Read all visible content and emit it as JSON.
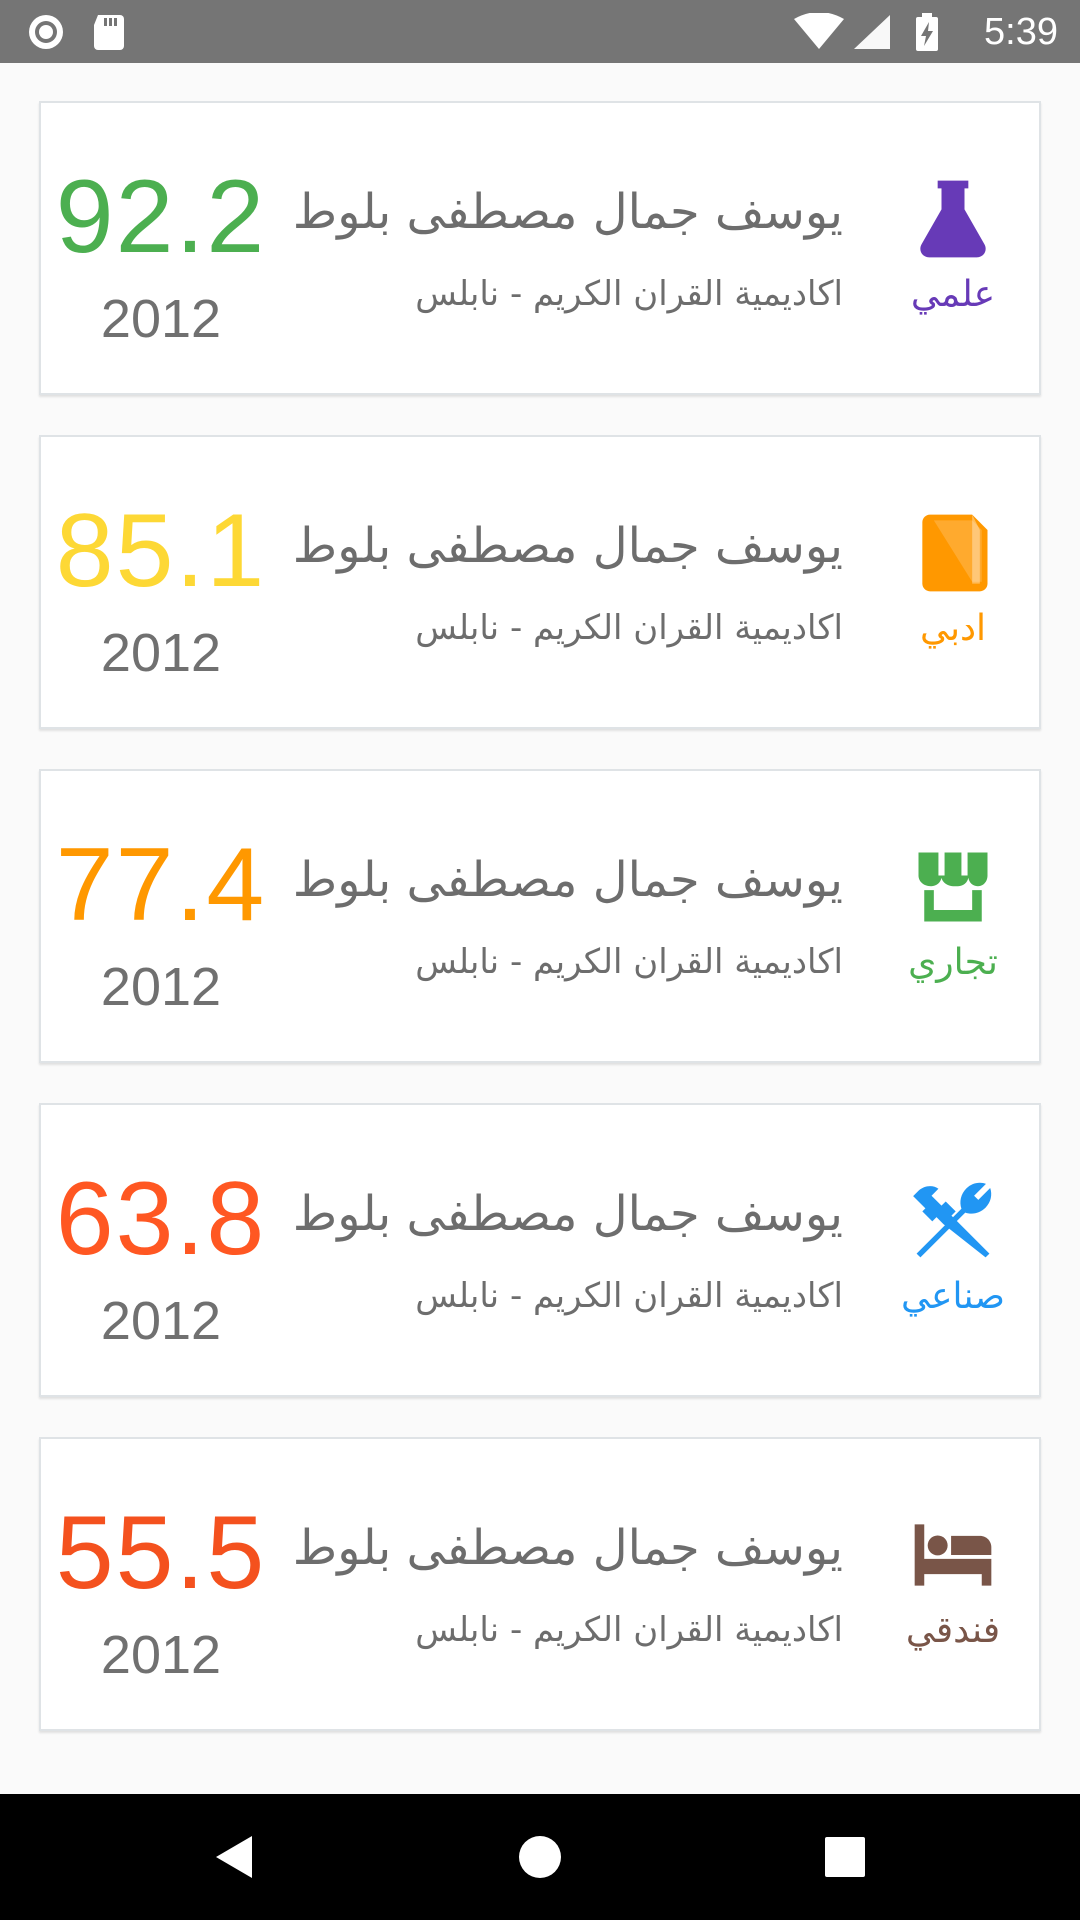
{
  "status_bar": {
    "time": "5:39",
    "left_icons": [
      "notification-circle-icon",
      "sd-card-icon"
    ],
    "right_icons": [
      "wifi-icon",
      "cell-signal-icon",
      "battery-charging-icon"
    ]
  },
  "results": [
    {
      "score": "92.2",
      "year": "2012",
      "name": "يوسف جمال مصطفى بلوط",
      "school": "اكاديمية القران الكريم - نابلس",
      "stream_label": "علمي",
      "stream_icon": "flask-icon",
      "score_color": "#4caf50",
      "stream_color": "#673ab7"
    },
    {
      "score": "85.1",
      "year": "2012",
      "name": "يوسف جمال مصطفى بلوط",
      "school": "اكاديمية القران الكريم - نابلس",
      "stream_label": "ادبي",
      "stream_icon": "book-icon",
      "score_color": "#fdd835",
      "stream_color": "#ff9800"
    },
    {
      "score": "77.4",
      "year": "2012",
      "name": "يوسف جمال مصطفى بلوط",
      "school": "اكاديمية القران الكريم - نابلس",
      "stream_label": "تجاري",
      "stream_icon": "storefront-icon",
      "score_color": "#ff9800",
      "stream_color": "#4caf50"
    },
    {
      "score": "63.8",
      "year": "2012",
      "name": "يوسف جمال مصطفى بلوط",
      "school": "اكاديمية القران الكريم - نابلس",
      "stream_label": "صناعي",
      "stream_icon": "tools-icon",
      "score_color": "#ff5722",
      "stream_color": "#2196f3"
    },
    {
      "score": "55.5",
      "year": "2012",
      "name": "يوسف جمال مصطفى بلوط",
      "school": "اكاديمية القران الكريم - نابلس",
      "stream_label": "فندقي",
      "stream_icon": "bed-icon",
      "score_color": "#f4511e",
      "stream_color": "#795548"
    }
  ],
  "nav_bar": {
    "buttons": [
      "back-triangle-icon",
      "home-circle-icon",
      "recents-square-icon"
    ]
  }
}
